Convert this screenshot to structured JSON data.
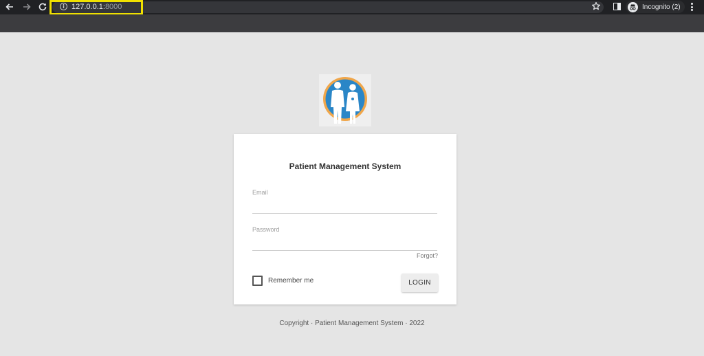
{
  "browser": {
    "url_host": "127.0.0.1:",
    "url_port": "8000",
    "incognito_label": "Incognito (2)"
  },
  "login": {
    "title": "Patient Management System",
    "email_label": "Email",
    "email_value": "",
    "password_label": "Password",
    "password_value": "",
    "forgot_label": "Forgot?",
    "remember_label": "Remember me",
    "login_label": "LOGIN"
  },
  "footer": {
    "copyright": "Copyright · Patient Management System · 2022"
  },
  "colors": {
    "page_background": "#e5e5e5",
    "logo_ring": "#f0a64a",
    "logo_fill": "#2a86c7",
    "highlight_box": "#f0e000"
  },
  "icons": [
    "back-arrow-icon",
    "forward-arrow-icon",
    "reload-icon",
    "info-icon",
    "star-icon",
    "side-panel-icon",
    "incognito-icon",
    "more-menu-icon",
    "doctors-logo"
  ]
}
